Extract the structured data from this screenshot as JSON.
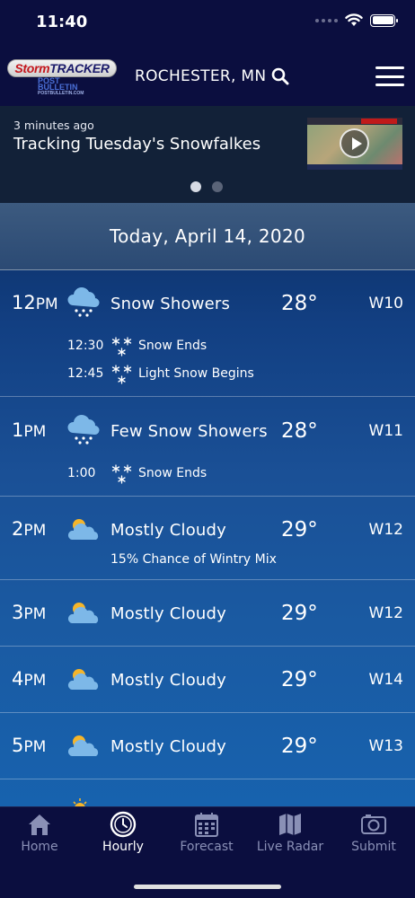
{
  "status_bar": {
    "time": "11:40"
  },
  "header": {
    "logo": {
      "storm": "Storm",
      "tracker": "TRACKER",
      "sub": "POST BULLETIN",
      "sub_small": "POSTBULLETIN.COM"
    },
    "location": "ROCHESTER, MN",
    "icons": {
      "search": "search-icon",
      "menu": "hamburger-menu-icon"
    }
  },
  "news": {
    "age": "3 minutes ago",
    "title": "Tracking Tuesday's Snowfalkes",
    "thumbnail_icon": "play-icon",
    "pages": 2,
    "active_page": 1
  },
  "date_header": "Today, April 14, 2020",
  "hours": [
    {
      "hour": "12",
      "ampm": "PM",
      "icon": "snow-cloud-icon",
      "condition": "Snow Showers",
      "temp": "28°",
      "wind": "W10",
      "details": [
        {
          "time": "12:30",
          "icon": "snowflakes-icon",
          "text": "Snow Ends"
        },
        {
          "time": "12:45",
          "icon": "snowflakes-icon",
          "text": "Light Snow Begins"
        }
      ]
    },
    {
      "hour": "1",
      "ampm": "PM",
      "icon": "snow-cloud-icon",
      "condition": "Few Snow Showers",
      "temp": "28°",
      "wind": "W11",
      "details": [
        {
          "time": "1:00",
          "icon": "snowflakes-icon",
          "text": "Snow Ends"
        }
      ]
    },
    {
      "hour": "2",
      "ampm": "PM",
      "icon": "partly-cloudy-icon",
      "condition": "Mostly Cloudy",
      "temp": "29°",
      "wind": "W12",
      "chance": "15% Chance of Wintry Mix"
    },
    {
      "hour": "3",
      "ampm": "PM",
      "icon": "partly-cloudy-icon",
      "condition": "Mostly Cloudy",
      "temp": "29°",
      "wind": "W12"
    },
    {
      "hour": "4",
      "ampm": "PM",
      "icon": "partly-cloudy-icon",
      "condition": "Mostly Cloudy",
      "temp": "29°",
      "wind": "W14"
    },
    {
      "hour": "5",
      "ampm": "PM",
      "icon": "partly-cloudy-icon",
      "condition": "Mostly Cloudy",
      "temp": "29°",
      "wind": "W13"
    }
  ],
  "tabs": [
    {
      "label": "Home",
      "icon": "home-icon",
      "active": false
    },
    {
      "label": "Hourly",
      "icon": "clock-icon",
      "active": true
    },
    {
      "label": "Forecast",
      "icon": "calendar-icon",
      "active": false
    },
    {
      "label": "Live Radar",
      "icon": "map-icon",
      "active": false
    },
    {
      "label": "Submit",
      "icon": "camera-icon",
      "active": false
    }
  ],
  "colors": {
    "background": "#0b0e3f",
    "accent": "#ffffff",
    "inactive_tab": "#8a90b6",
    "sun": "#f5b52a",
    "cloud": "#7db8e8"
  }
}
